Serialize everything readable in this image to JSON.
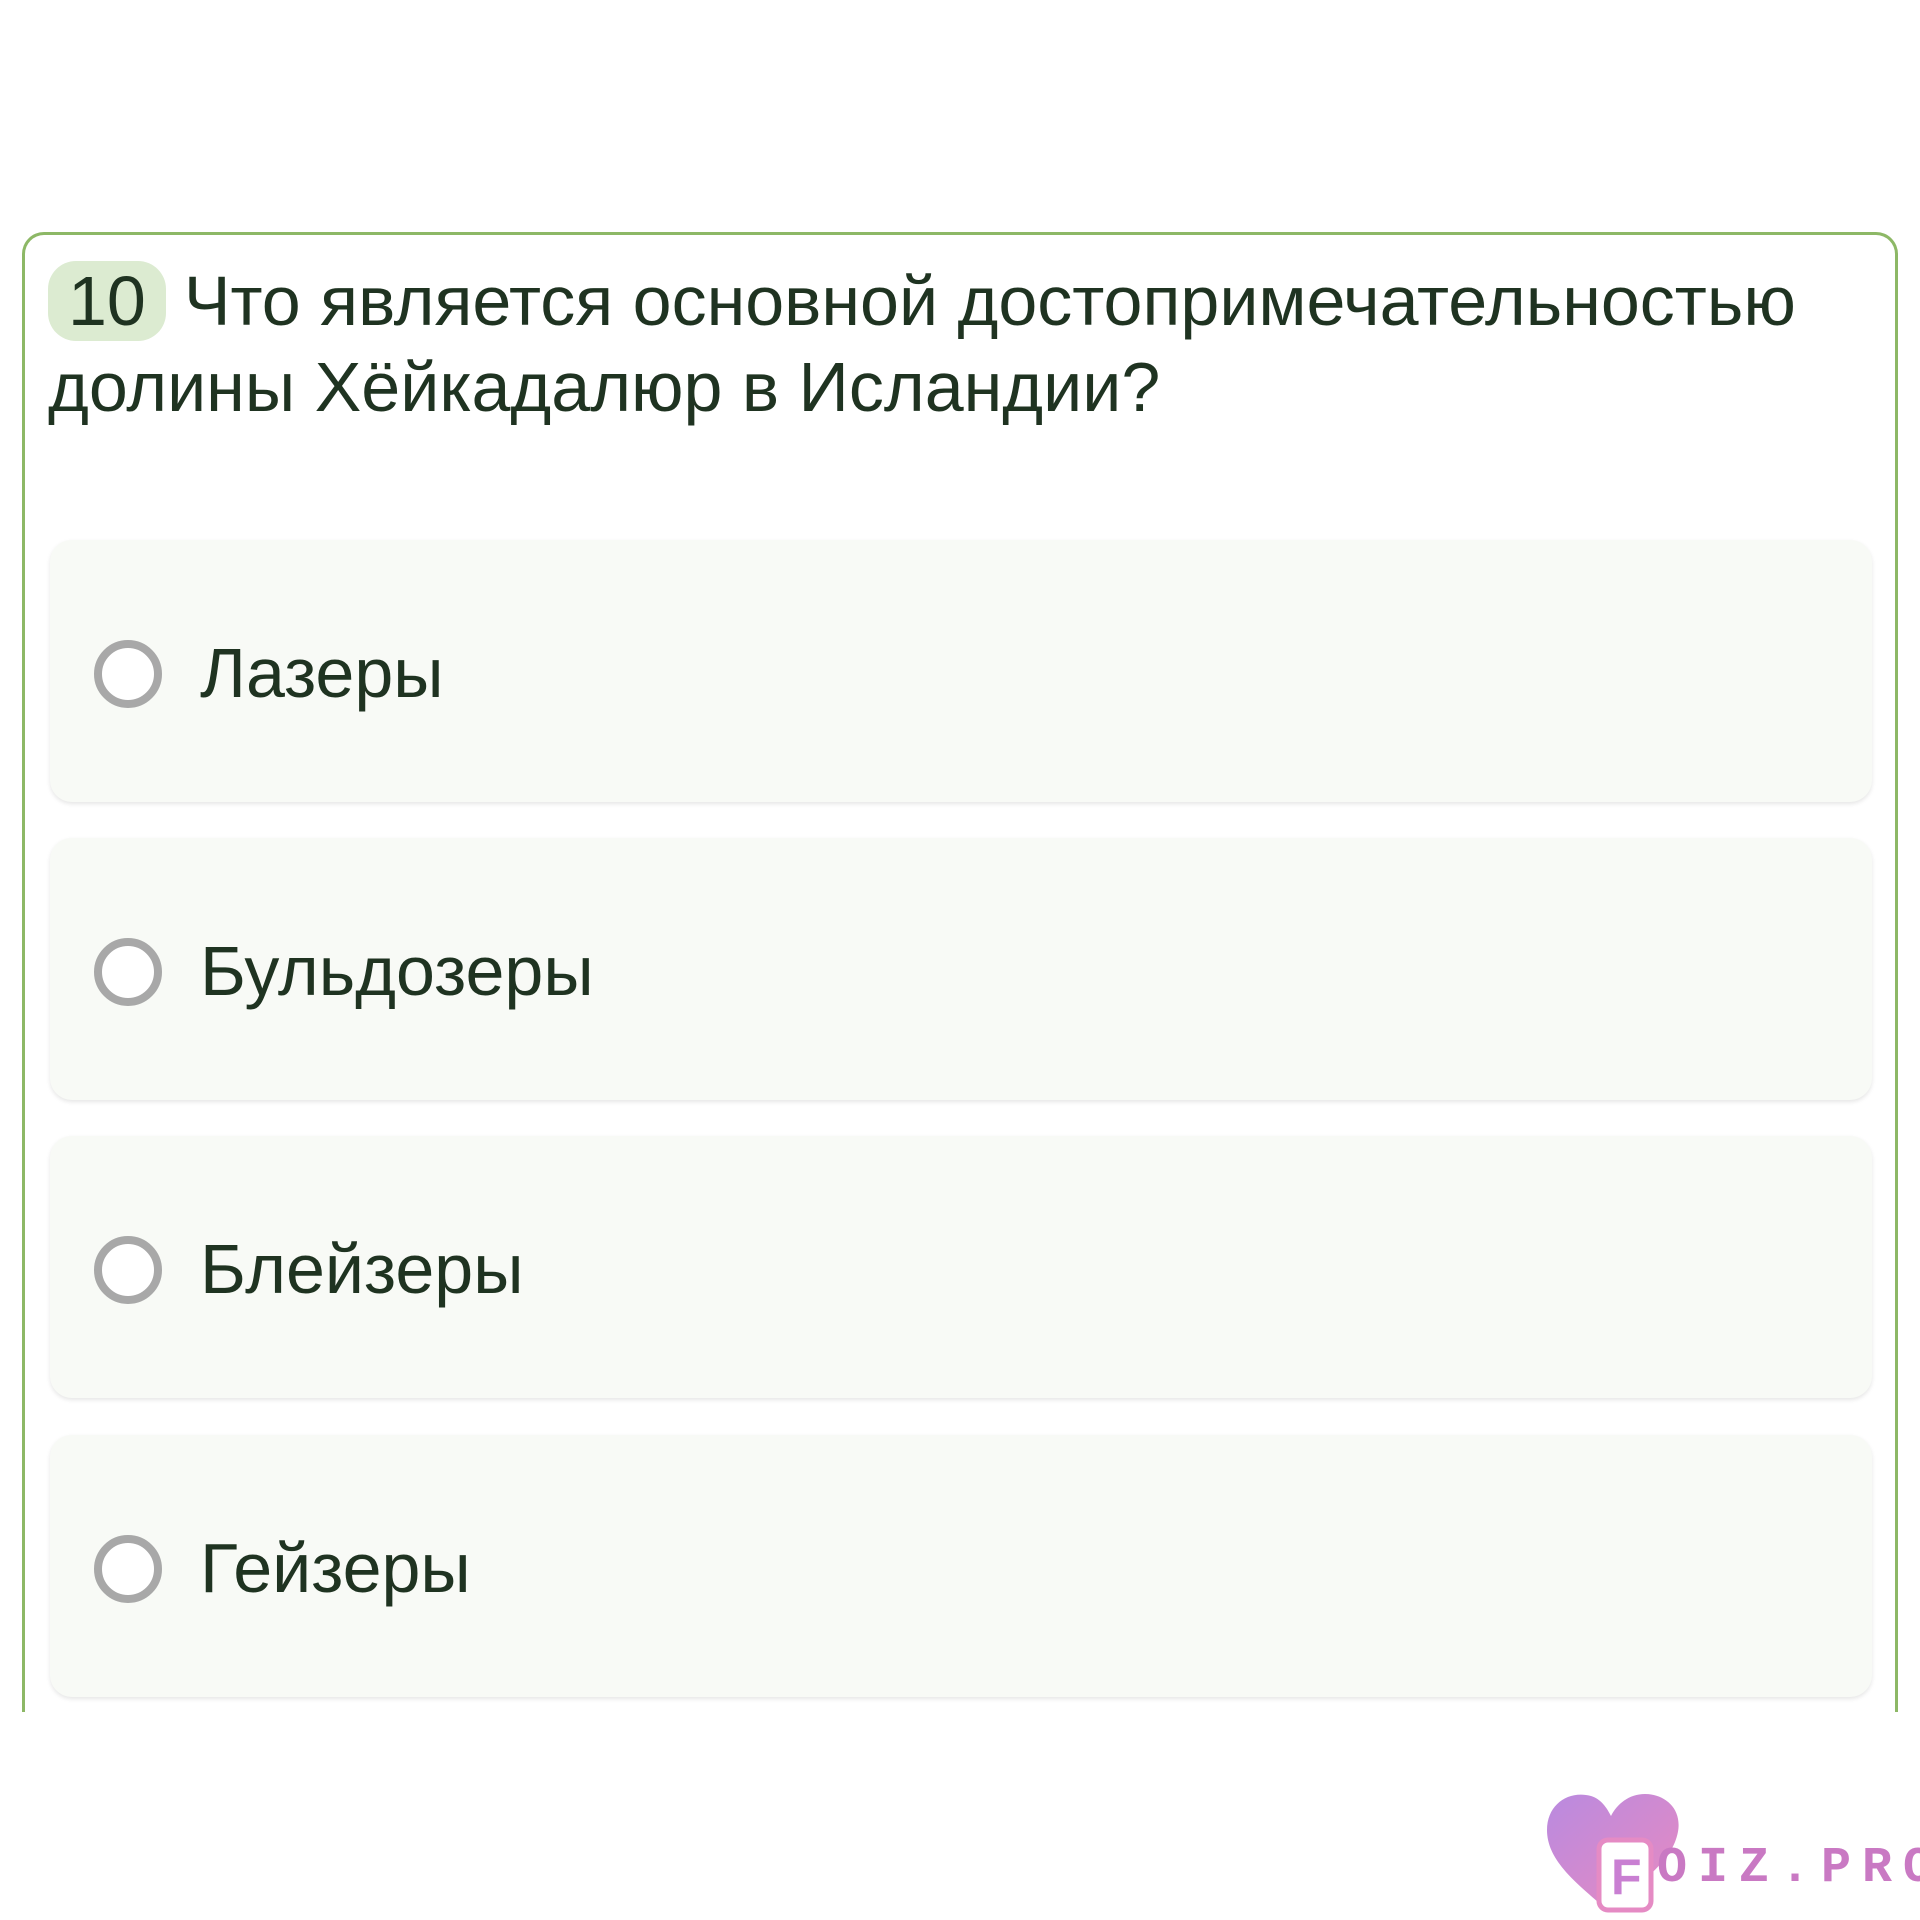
{
  "question": {
    "number": "10",
    "text": "Что является основной достопримечательностью долины Хёйкадалюр в Исландии?"
  },
  "options": [
    {
      "label": "Лазеры",
      "selected": false
    },
    {
      "label": "Бульдозеры",
      "selected": false
    },
    {
      "label": "Блейзеры",
      "selected": false
    },
    {
      "label": "Гейзеры",
      "selected": false
    }
  ],
  "watermark": {
    "text": "OIZ.PRO",
    "letter": "F",
    "colors": {
      "heart": "#c07fd6",
      "accent": "#e58bc4"
    }
  },
  "colors": {
    "card_border": "#8db866",
    "badge_bg": "#dcebd1",
    "option_bg": "#f8faf6",
    "text": "#1f3321",
    "radio": "#a8a8a8"
  }
}
